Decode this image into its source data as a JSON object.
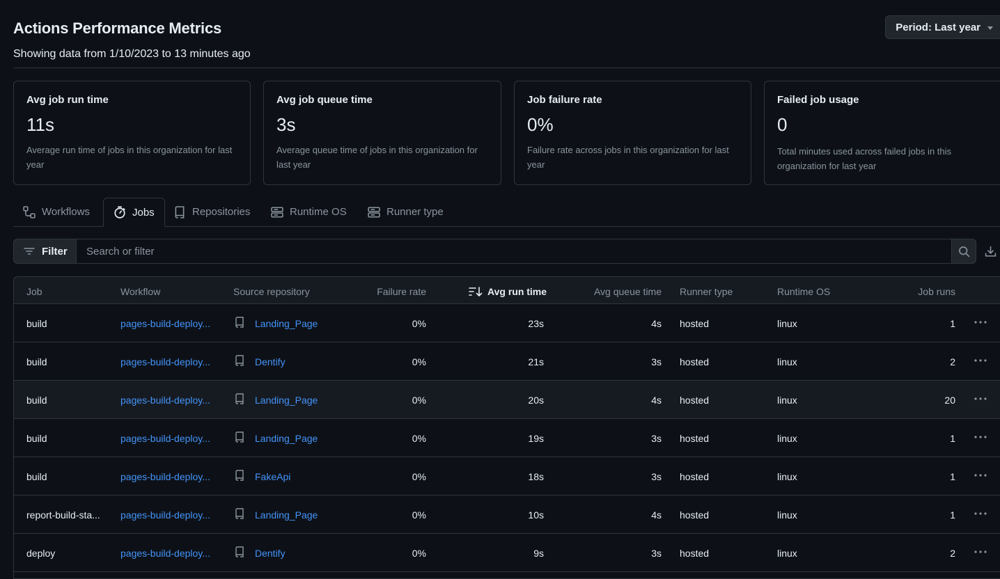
{
  "header": {
    "title": "Actions Performance Metrics",
    "subtitle": "Showing data from 1/10/2023 to 13 minutes ago",
    "period_label": "Period: Last year"
  },
  "cards": [
    {
      "title": "Avg job run time",
      "value": "11s",
      "desc": "Average run time of jobs in this organization for last year"
    },
    {
      "title": "Avg job queue time",
      "value": "3s",
      "desc": "Average queue time of jobs in this organization for last year"
    },
    {
      "title": "Job failure rate",
      "value": "0%",
      "desc": "Failure rate across jobs in this organization for last year"
    },
    {
      "title": "Failed job usage",
      "value": "0",
      "desc": "Total minutes used across failed jobs in this organization for last year"
    }
  ],
  "tabs": [
    {
      "label": "Workflows",
      "icon": "workflow-icon"
    },
    {
      "label": "Jobs",
      "icon": "stopwatch-icon",
      "active": true
    },
    {
      "label": "Repositories",
      "icon": "repo-icon"
    },
    {
      "label": "Runtime OS",
      "icon": "server-icon"
    },
    {
      "label": "Runner type",
      "icon": "server-icon"
    }
  ],
  "filter": {
    "button_label": "Filter",
    "placeholder": "Search or filter"
  },
  "table": {
    "columns": [
      "Job",
      "Workflow",
      "Source repository",
      "Failure rate",
      "Avg run time",
      "Avg queue time",
      "Runner type",
      "Runtime OS",
      "Job runs"
    ],
    "sorted_column": "Avg run time",
    "rows": [
      {
        "job": "build",
        "workflow": "pages-build-deploy...",
        "repo": "Landing_Page",
        "failure": "0%",
        "run": "23s",
        "queue": "4s",
        "runner": "hosted",
        "os": "linux",
        "runs": "1"
      },
      {
        "job": "build",
        "workflow": "pages-build-deploy...",
        "repo": "Dentify",
        "failure": "0%",
        "run": "21s",
        "queue": "3s",
        "runner": "hosted",
        "os": "linux",
        "runs": "2"
      },
      {
        "job": "build",
        "workflow": "pages-build-deploy...",
        "repo": "Landing_Page",
        "failure": "0%",
        "run": "20s",
        "queue": "4s",
        "runner": "hosted",
        "os": "linux",
        "runs": "20"
      },
      {
        "job": "build",
        "workflow": "pages-build-deploy...",
        "repo": "Landing_Page",
        "failure": "0%",
        "run": "19s",
        "queue": "3s",
        "runner": "hosted",
        "os": "linux",
        "runs": "1"
      },
      {
        "job": "build",
        "workflow": "pages-build-deploy...",
        "repo": "FakeApi",
        "failure": "0%",
        "run": "18s",
        "queue": "3s",
        "runner": "hosted",
        "os": "linux",
        "runs": "1"
      },
      {
        "job": "report-build-sta...",
        "workflow": "pages-build-deploy...",
        "repo": "Landing_Page",
        "failure": "0%",
        "run": "10s",
        "queue": "4s",
        "runner": "hosted",
        "os": "linux",
        "runs": "1"
      },
      {
        "job": "deploy",
        "workflow": "pages-build-deploy...",
        "repo": "Dentify",
        "failure": "0%",
        "run": "9s",
        "queue": "3s",
        "runner": "hosted",
        "os": "linux",
        "runs": "2"
      }
    ]
  }
}
